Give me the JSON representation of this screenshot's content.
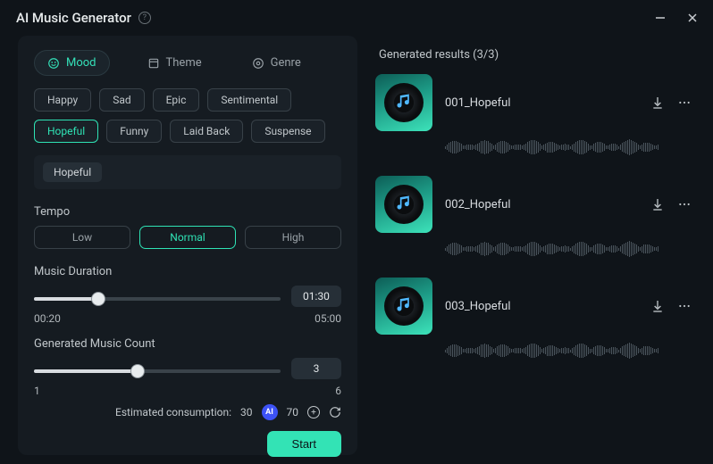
{
  "app_title": "AI Music Generator",
  "tabs": [
    {
      "id": "mood",
      "label": "Mood",
      "active": true
    },
    {
      "id": "theme",
      "label": "Theme",
      "active": false
    },
    {
      "id": "genre",
      "label": "Genre",
      "active": false
    }
  ],
  "mood_chips": [
    {
      "label": "Happy",
      "active": false
    },
    {
      "label": "Sad",
      "active": false
    },
    {
      "label": "Epic",
      "active": false
    },
    {
      "label": "Sentimental",
      "active": false
    },
    {
      "label": "Hopeful",
      "active": true
    },
    {
      "label": "Funny",
      "active": false
    },
    {
      "label": "Laid Back",
      "active": false
    },
    {
      "label": "Suspense",
      "active": false
    }
  ],
  "selected_mood": "Hopeful",
  "tempo": {
    "label": "Tempo",
    "options": [
      "Low",
      "Normal",
      "High"
    ],
    "selected": "Normal"
  },
  "duration": {
    "label": "Music Duration",
    "min_label": "00:20",
    "max_label": "05:00",
    "value_label": "01:30",
    "fill_pct": 26
  },
  "count": {
    "label": "Generated Music Count",
    "min_label": "1",
    "max_label": "6",
    "value_label": "3",
    "fill_pct": 42
  },
  "consumption": {
    "label": "Estimated consumption:",
    "value": "30",
    "balance": "70"
  },
  "start_label": "Start",
  "results": {
    "title": "Generated results (3/3)",
    "items": [
      {
        "name": "001_Hopeful"
      },
      {
        "name": "002_Hopeful"
      },
      {
        "name": "003_Hopeful"
      }
    ]
  }
}
